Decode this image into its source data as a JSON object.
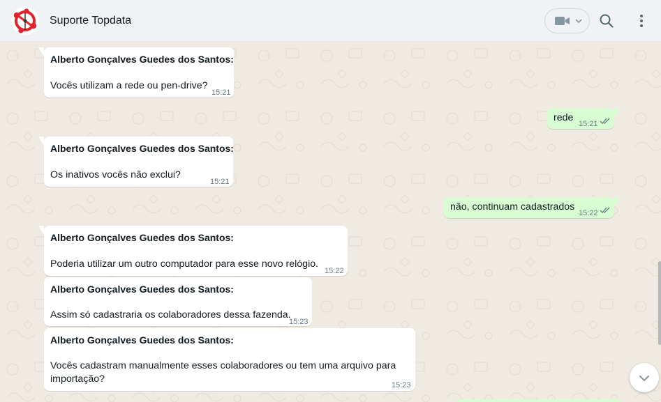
{
  "header": {
    "title": "Suporte Topdata",
    "avatar_icon": "topdata-logo-icon",
    "video_icon": "video-camera-icon",
    "search_icon": "search-icon",
    "menu_icon": "more-vertical-icon"
  },
  "colors": {
    "header_bg": "#f0f2f5",
    "chat_bg": "#efeae2",
    "incoming_bubble": "#ffffff",
    "outgoing_bubble": "#d9fdd3",
    "logo_red": "#e1232b",
    "tick_color": "#667781"
  },
  "messages": [
    {
      "direction": "in",
      "sender": "Alberto Gonçalves Guedes dos Santos:",
      "text": "Vocês utilizam a rede ou pen-drive?",
      "time": "15:21"
    },
    {
      "direction": "out",
      "text": "rede",
      "time": "15:21",
      "status": "double-check-icon"
    },
    {
      "direction": "in",
      "sender": "Alberto Gonçalves Guedes dos Santos:",
      "text": "Os inativos vocês não exclui?",
      "time": "15:21"
    },
    {
      "direction": "out",
      "text": "não, continuam cadastrados",
      "time": "15:22",
      "status": "double-check-icon"
    },
    {
      "direction": "in",
      "sender": "Alberto Gonçalves Guedes dos Santos:",
      "text": "Poderia utilizar um outro computador para esse novo relógio.",
      "time": "15:22"
    },
    {
      "direction": "in",
      "sender": "Alberto Gonçalves Guedes dos Santos:",
      "text": "Assim só cadastraria os colaboradores dessa fazenda.",
      "time": "15:23"
    },
    {
      "direction": "in",
      "sender": "Alberto Gonçalves Guedes dos Santos:",
      "text_lines": [
        "Vocês cadastram manualmente esses colaboradores ou tem uma arquivo para",
        "importação?"
      ],
      "time": "15:23"
    }
  ],
  "scroll_down_icon": "chevron-down-icon"
}
